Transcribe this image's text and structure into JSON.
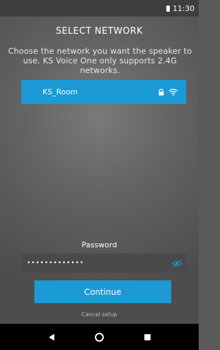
{
  "status_bar": {
    "time": "11:30",
    "battery_icon": "battery-icon"
  },
  "header": {
    "title": "SELECT NETWORK"
  },
  "description": "Choose the network you want the speaker to use. KS Voice One only supports 2.4G networks.",
  "networks": [
    {
      "name": "KS_Room",
      "secured": true,
      "signal": "wifi-icon",
      "selected": true
    }
  ],
  "password": {
    "label": "Password",
    "value": "•••••••••••••",
    "toggle_icon": "eye-toggle-icon"
  },
  "actions": {
    "continue_label": "Continue",
    "cancel_label": "Cancel setup"
  },
  "navbar": {
    "back_icon": "back-icon",
    "home_icon": "home-icon",
    "recents_icon": "recents-icon"
  },
  "colors": {
    "accent": "#1b9ad6",
    "background": "#5a5a5a",
    "navbar": "#000000"
  }
}
